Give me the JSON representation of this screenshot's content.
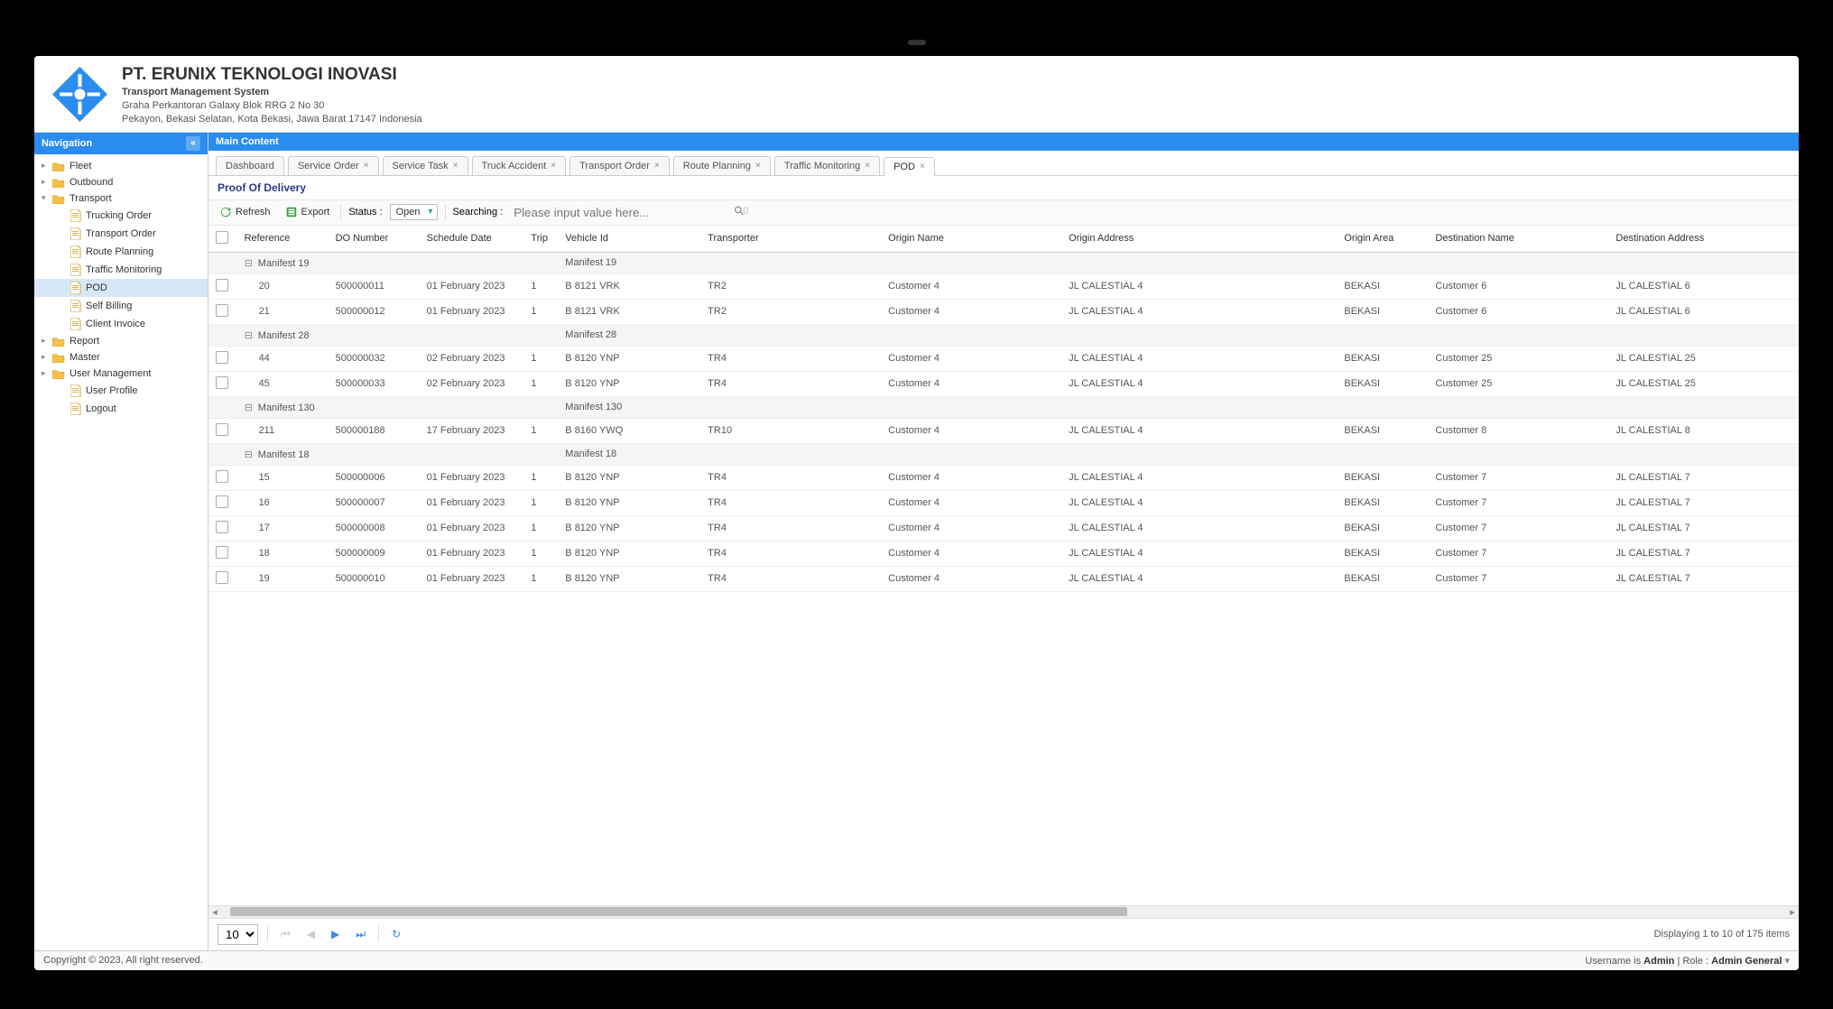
{
  "header": {
    "company": "PT. ERUNIX TEKNOLOGI INOVASI",
    "subtitle": "Transport Management System",
    "addr1": "Graha Perkantoran Galaxy Blok RRG 2 No 30",
    "addr2": "Pekayon, Bekasi Selatan, Kota Bekasi, Jawa Barat 17147 Indonesia"
  },
  "nav": {
    "title": "Navigation",
    "items": [
      {
        "label": "Fleet",
        "type": "folder",
        "level": 1,
        "expander": "▸"
      },
      {
        "label": "Outbound",
        "type": "folder",
        "level": 1,
        "expander": "▸"
      },
      {
        "label": "Transport",
        "type": "folder",
        "level": 1,
        "expander": "▾",
        "open": true
      },
      {
        "label": "Trucking Order",
        "type": "file",
        "level": 2
      },
      {
        "label": "Transport Order",
        "type": "file",
        "level": 2
      },
      {
        "label": "Route Planning",
        "type": "file",
        "level": 2
      },
      {
        "label": "Traffic Monitoring",
        "type": "file",
        "level": 2
      },
      {
        "label": "POD",
        "type": "file",
        "level": 2,
        "selected": true
      },
      {
        "label": "Self Billing",
        "type": "file",
        "level": 2
      },
      {
        "label": "Client Invoice",
        "type": "file",
        "level": 2
      },
      {
        "label": "Report",
        "type": "folder",
        "level": 1,
        "expander": "▸"
      },
      {
        "label": "Master",
        "type": "folder",
        "level": 1,
        "expander": "▸"
      },
      {
        "label": "User Management",
        "type": "folder",
        "level": 1,
        "expander": "▸"
      },
      {
        "label": "User Profile",
        "type": "file",
        "level": 2
      },
      {
        "label": "Logout",
        "type": "file",
        "level": 2
      }
    ]
  },
  "main": {
    "title": "Main Content",
    "tabs": [
      {
        "label": "Dashboard",
        "closable": false
      },
      {
        "label": "Service Order",
        "closable": true
      },
      {
        "label": "Service Task",
        "closable": true
      },
      {
        "label": "Truck Accident",
        "closable": true
      },
      {
        "label": "Transport Order",
        "closable": true
      },
      {
        "label": "Route Planning",
        "closable": true
      },
      {
        "label": "Traffic Monitoring",
        "closable": true
      },
      {
        "label": "POD",
        "closable": true,
        "active": true
      }
    ],
    "section": "Proof Of Delivery",
    "toolbar": {
      "refresh": "Refresh",
      "export": "Export",
      "status_label": "Status :",
      "status_value": "Open",
      "search_label": "Searching :",
      "search_placeholder": "Please input value here..."
    },
    "columns": [
      "",
      "Reference",
      "DO Number",
      "Schedule Date",
      "Trip",
      "Vehicle Id",
      "Transporter",
      "Origin Name",
      "Origin Address",
      "Origin Area",
      "Destination Name",
      "Destination Address"
    ],
    "groups": [
      {
        "title": "Manifest 19",
        "vehicle": "Manifest 19",
        "rows": [
          {
            "ref": "20",
            "do": "500000011",
            "date": "01 February 2023",
            "trip": "1",
            "vid": "B 8121 VRK",
            "tr": "TR2",
            "on": "Customer 4",
            "oa": "JL CALESTIAL 4",
            "area": "BEKASI",
            "dn": "Customer 6",
            "da": "JL CALESTIAL 6"
          },
          {
            "ref": "21",
            "do": "500000012",
            "date": "01 February 2023",
            "trip": "1",
            "vid": "B 8121 VRK",
            "tr": "TR2",
            "on": "Customer 4",
            "oa": "JL CALESTIAL 4",
            "area": "BEKASI",
            "dn": "Customer 6",
            "da": "JL CALESTIAL 6"
          }
        ]
      },
      {
        "title": "Manifest 28",
        "vehicle": "Manifest 28",
        "rows": [
          {
            "ref": "44",
            "do": "500000032",
            "date": "02 February 2023",
            "trip": "1",
            "vid": "B 8120 YNP",
            "tr": "TR4",
            "on": "Customer 4",
            "oa": "JL CALESTIAL 4",
            "area": "BEKASI",
            "dn": "Customer 25",
            "da": "JL CALESTIAL 25"
          },
          {
            "ref": "45",
            "do": "500000033",
            "date": "02 February 2023",
            "trip": "1",
            "vid": "B 8120 YNP",
            "tr": "TR4",
            "on": "Customer 4",
            "oa": "JL CALESTIAL 4",
            "area": "BEKASI",
            "dn": "Customer 25",
            "da": "JL CALESTIAL 25"
          }
        ]
      },
      {
        "title": "Manifest 130",
        "vehicle": "Manifest 130",
        "rows": [
          {
            "ref": "211",
            "do": "500000188",
            "date": "17 February 2023",
            "trip": "1",
            "vid": "B 8160 YWQ",
            "tr": "TR10",
            "on": "Customer 4",
            "oa": "JL CALESTIAL 4",
            "area": "BEKASI",
            "dn": "Customer 8",
            "da": "JL CALESTIAL 8"
          }
        ]
      },
      {
        "title": "Manifest 18",
        "vehicle": "Manifest 18",
        "rows": [
          {
            "ref": "15",
            "do": "500000006",
            "date": "01 February 2023",
            "trip": "1",
            "vid": "B 8120 YNP",
            "tr": "TR4",
            "on": "Customer 4",
            "oa": "JL CALESTIAL 4",
            "area": "BEKASI",
            "dn": "Customer 7",
            "da": "JL CALESTIAL 7"
          },
          {
            "ref": "16",
            "do": "500000007",
            "date": "01 February 2023",
            "trip": "1",
            "vid": "B 8120 YNP",
            "tr": "TR4",
            "on": "Customer 4",
            "oa": "JL CALESTIAL 4",
            "area": "BEKASI",
            "dn": "Customer 7",
            "da": "JL CALESTIAL 7"
          },
          {
            "ref": "17",
            "do": "500000008",
            "date": "01 February 2023",
            "trip": "1",
            "vid": "B 8120 YNP",
            "tr": "TR4",
            "on": "Customer 4",
            "oa": "JL CALESTIAL 4",
            "area": "BEKASI",
            "dn": "Customer 7",
            "da": "JL CALESTIAL 7"
          },
          {
            "ref": "18",
            "do": "500000009",
            "date": "01 February 2023",
            "trip": "1",
            "vid": "B 8120 YNP",
            "tr": "TR4",
            "on": "Customer 4",
            "oa": "JL CALESTIAL 4",
            "area": "BEKASI",
            "dn": "Customer 7",
            "da": "JL CALESTIAL 7"
          },
          {
            "ref": "19",
            "do": "500000010",
            "date": "01 February 2023",
            "trip": "1",
            "vid": "B 8120 YNP",
            "tr": "TR4",
            "on": "Customer 4",
            "oa": "JL CALESTIAL 4",
            "area": "BEKASI",
            "dn": "Customer 7",
            "da": "JL CALESTIAL 7"
          }
        ]
      }
    ],
    "pager": {
      "page_size": "10",
      "summary": "Displaying 1 to 10 of 175 items"
    }
  },
  "footer": {
    "left": "Copyright © 2023, All right reserved.",
    "user_label": "Username is ",
    "user_value": "Admin",
    "role_label": " | Role : ",
    "role_value": "Admin General"
  }
}
